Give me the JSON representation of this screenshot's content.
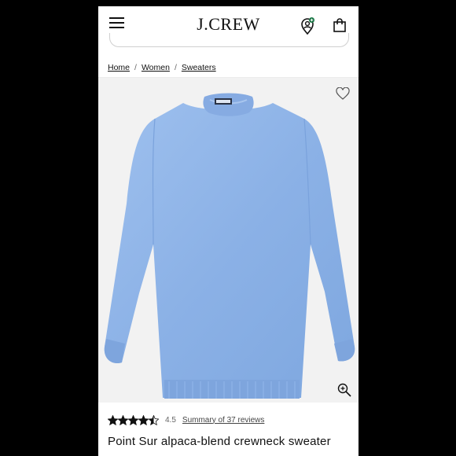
{
  "header": {
    "logo": "J.CREW",
    "icons": [
      "menu-icon",
      "user-icon",
      "bag-icon"
    ],
    "user_badge_color": "#1f7a4a"
  },
  "breadcrumb": {
    "items": [
      "Home",
      "Women",
      "Sweaters"
    ],
    "separator": "/"
  },
  "product": {
    "title": "Point Sur alpaca-blend crewneck sweater",
    "rating_value": "4.5",
    "rating": 4.5,
    "reviews_link": "Summary of 37 reviews",
    "image_background": "#f2f2f2",
    "sweater_color": "#8fb4e8",
    "icons": [
      "heart-icon",
      "zoom-icon"
    ]
  }
}
